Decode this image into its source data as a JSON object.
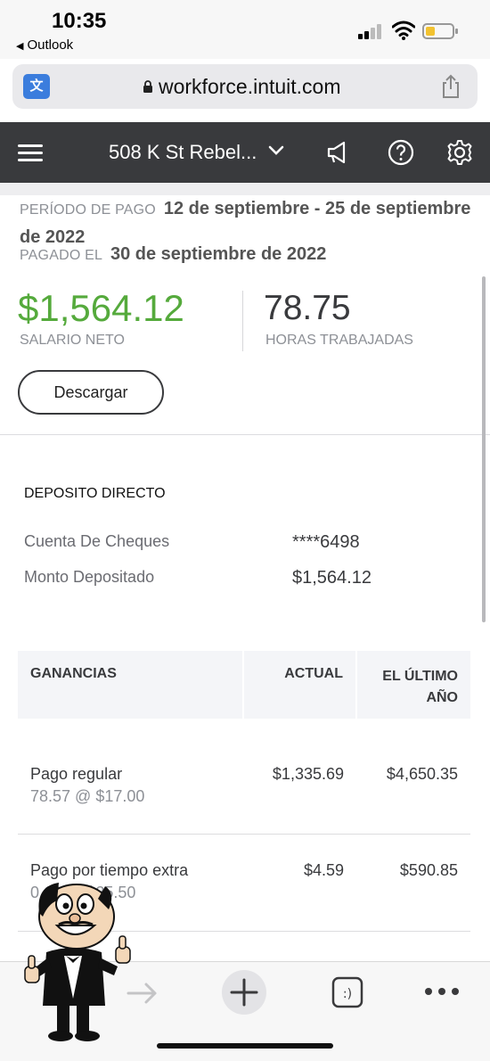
{
  "status_bar": {
    "time": "10:35",
    "back_app": "Outlook"
  },
  "url_bar": {
    "url": "workforce.intuit.com"
  },
  "header": {
    "company": "508 K St Rebel..."
  },
  "pay": {
    "period_label": "PERÍODO DE PAGO",
    "period_value": "12 de septiembre - 25 de septiembre de 2022",
    "paid_label": "PAGADO EL",
    "paid_value": "30 de septiembre de 2022",
    "net_amount": "$1,564.12",
    "net_label": "SALARIO NETO",
    "hours": "78.75",
    "hours_label": "HORAS TRABAJADAS",
    "download_button": "Descargar"
  },
  "direct_deposit": {
    "title": "DEPOSITO DIRECTO",
    "rows": [
      {
        "label": "Cuenta De Cheques",
        "value": "****6498"
      },
      {
        "label": "Monto Depositado",
        "value": "$1,564.12"
      }
    ]
  },
  "earnings": {
    "headers": {
      "name": "GANANCIAS",
      "current": "ACTUAL",
      "ytd": "EL ÚLTIMO AÑO"
    },
    "rows": [
      {
        "name": "Pago regular",
        "detail": "78.57 @ $17.00",
        "current": "$1,335.69",
        "ytd": "$4,650.35"
      },
      {
        "name": "Pago por tiempo extra",
        "detail": "0.18 @ $25.50",
        "current": "$4.59",
        "ytd": "$590.85"
      }
    ]
  },
  "colors": {
    "header_bg": "#393a3d",
    "net_green": "#55aa3c"
  }
}
